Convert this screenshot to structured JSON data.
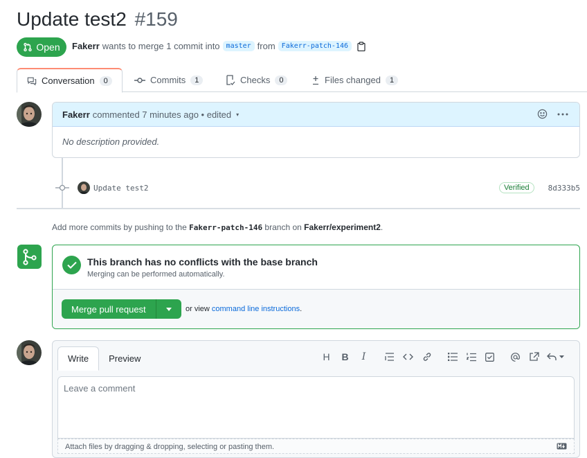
{
  "pr": {
    "title": "Update test2",
    "number": "#159",
    "state": "Open",
    "author": "Fakerr",
    "merge_text": "wants to merge 1 commit into",
    "base_branch": "master",
    "from_text": "from",
    "head_branch": "Fakerr-patch-146"
  },
  "tabs": [
    {
      "label": "Conversation",
      "count": "0"
    },
    {
      "label": "Commits",
      "count": "1"
    },
    {
      "label": "Checks",
      "count": "0"
    },
    {
      "label": "Files changed",
      "count": "1"
    }
  ],
  "comment": {
    "author": "Fakerr",
    "meta": "commented 7 minutes ago • edited",
    "body": "No description provided."
  },
  "commit": {
    "message": "Update test2",
    "badge": "Verified",
    "sha": "8d333b5"
  },
  "hint": {
    "pre": "Add more commits by pushing to the",
    "branch": "Fakerr-patch-146",
    "mid": "branch on",
    "repo": "Fakerr/experiment2",
    "end": "."
  },
  "merge": {
    "title": "This branch has no conflicts with the base branch",
    "subtitle": "Merging can be performed automatically.",
    "button": "Merge pull request",
    "or_view": "or view",
    "cli_link": "command line instructions",
    "cli_end": "."
  },
  "write": {
    "tab_write": "Write",
    "tab_preview": "Preview",
    "placeholder": "Leave a comment",
    "attach": "Attach files by dragging & dropping, selecting or pasting them.",
    "toolbar_glyphs": {
      "heading": "H",
      "bold": "B",
      "italic": "I"
    }
  },
  "colors": {
    "accent_green": "#2da44e",
    "link_blue": "#0969da",
    "tab_active_border": "#fd8c73"
  }
}
